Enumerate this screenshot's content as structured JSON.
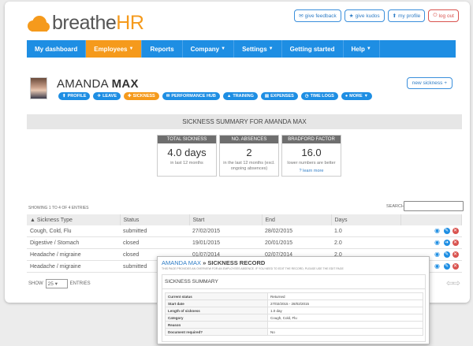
{
  "brand": {
    "name_part1": "breathe",
    "name_part2": "HR"
  },
  "top_links": [
    {
      "label": "give feedback",
      "icon": "chat-icon"
    },
    {
      "label": "give kudos",
      "icon": "star-icon"
    },
    {
      "label": "my profile",
      "icon": "user-icon"
    },
    {
      "label": "log out",
      "icon": "logout-icon"
    }
  ],
  "nav": [
    {
      "label": "My dashboard",
      "caret": ""
    },
    {
      "label": "Employees",
      "caret": "▼"
    },
    {
      "label": "Reports",
      "caret": ""
    },
    {
      "label": "Company",
      "caret": "▼"
    },
    {
      "label": "Settings",
      "caret": "▼"
    },
    {
      "label": "Getting started",
      "caret": ""
    },
    {
      "label": "Help",
      "caret": "▼"
    }
  ],
  "person": {
    "first": "AMANDA",
    "last": "MAX"
  },
  "new_sickness": "new sickness +",
  "tabs": [
    {
      "label": "PROFILE",
      "icon": "user-icon"
    },
    {
      "label": "LEAVE",
      "icon": "plane-icon"
    },
    {
      "label": "SICKNESS",
      "icon": "medical-bag-icon"
    },
    {
      "label": "PERFORMANCE HUB",
      "icon": "chat-icon"
    },
    {
      "label": "TRAINING",
      "icon": "graduation-cap-icon"
    },
    {
      "label": "EXPENSES",
      "icon": "receipt-icon"
    },
    {
      "label": "TIME LOGS",
      "icon": "clock-icon"
    },
    {
      "label": "MORE",
      "icon": "more-icon"
    }
  ],
  "summary_title": "SICKNESS SUMMARY FOR AMANDA MAX",
  "stats": [
    {
      "header": "TOTAL SICKNESS",
      "value": "4.0 days",
      "sub": "in last 12 months",
      "link": ""
    },
    {
      "header": "NO. ABSENCES",
      "value": "2",
      "sub": "in the last 12 months (excl. ongoing absences)",
      "link": ""
    },
    {
      "header": "BRADFORD FACTOR",
      "value": "16.0",
      "sub": "lower numbers are better",
      "link": "learn more"
    }
  ],
  "entries_info": "SHOWING 1 TO 4 OF 4 ENTRIES",
  "search_label": "SEARCH:",
  "search_value": "",
  "table": {
    "headers": [
      "Sickness Type",
      "Status",
      "Start",
      "End",
      "Days",
      ""
    ],
    "rows": [
      [
        "Cough, Cold, Flu",
        "submitted",
        "27/02/2015",
        "28/02/2015",
        "1.0"
      ],
      [
        "Digestive / Stomach",
        "closed",
        "19/01/2015",
        "20/01/2015",
        "2.0"
      ],
      [
        "Headache / migraine",
        "closed",
        "01/07/2014",
        "02/07/2014",
        "2.0"
      ],
      [
        "Headache / migraine",
        "submitted",
        "",
        "",
        ""
      ]
    ]
  },
  "show": {
    "label": "SHOW",
    "value": "25",
    "suffix": "ENTRIES"
  },
  "pager_icons": "⇦⇨",
  "popup": {
    "name": "AMANDA MAX",
    "sep": "»",
    "title": "SICKNESS RECORD",
    "note": "THIS PAGE PROVIDES AN OVERVIEW FOR AN EMPLOYEES ABSENCE. IF YOU NEED TO EDIT THE RECORD, PLEASE USE THE EDIT PAGE",
    "section": "SICKNESS SUMMARY",
    "fields": [
      {
        "k": "Current status",
        "v": "Returned"
      },
      {
        "k": "Start date",
        "v": "27/02/2015 - 28/02/2015"
      },
      {
        "k": "Length of sickness",
        "v": "1.0 day"
      },
      {
        "k": "Category",
        "v": "Cough, Cold, Flu"
      },
      {
        "k": "Reason",
        "v": ""
      },
      {
        "k": "Document required?",
        "v": "No"
      }
    ]
  },
  "colors": {
    "primary": "#1e8ee3",
    "accent": "#f59a1c",
    "danger": "#d9534f"
  }
}
